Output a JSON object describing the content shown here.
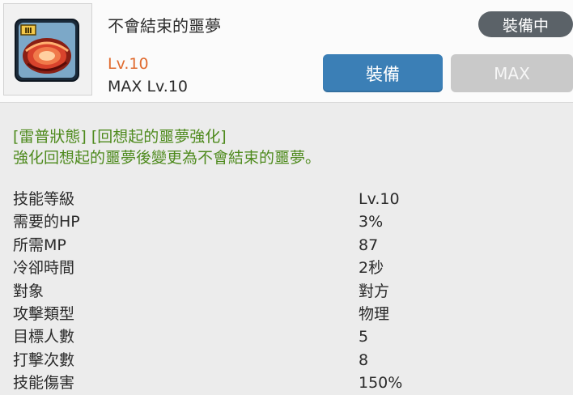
{
  "skill": {
    "name": "不會結束的噩夢",
    "level_label": "Lv.10",
    "max_level_label": "MAX Lv.10",
    "icon": "nightmare-skill-icon"
  },
  "status_badge": "裝備中",
  "buttons": {
    "equip_label": "裝備",
    "max_label": "MAX"
  },
  "description": {
    "tag_line": "[雷普狀態] [回想起的噩夢強化]",
    "effect_line": "強化回想起的噩夢後變更為不會結束的噩夢。"
  },
  "stats": [
    {
      "label": "技能等級",
      "value": "Lv.10"
    },
    {
      "label": "需要的HP",
      "value": "3%"
    },
    {
      "label": "所需MP",
      "value": "87"
    },
    {
      "label": "冷卻時間",
      "value": "2秒"
    },
    {
      "label": "對象",
      "value": "對方"
    },
    {
      "label": "攻擊類型",
      "value": "物理"
    },
    {
      "label": "目標人數",
      "value": "5"
    },
    {
      "label": "打擊次數",
      "value": "8"
    },
    {
      "label": "技能傷害",
      "value": "150%"
    }
  ],
  "colors": {
    "level_accent": "#e06b2f",
    "description_green": "#4e8a1d",
    "equip_button": "#3b7fb6",
    "badge": "#5b6268",
    "max_button_disabled": "#c9c9c9"
  }
}
